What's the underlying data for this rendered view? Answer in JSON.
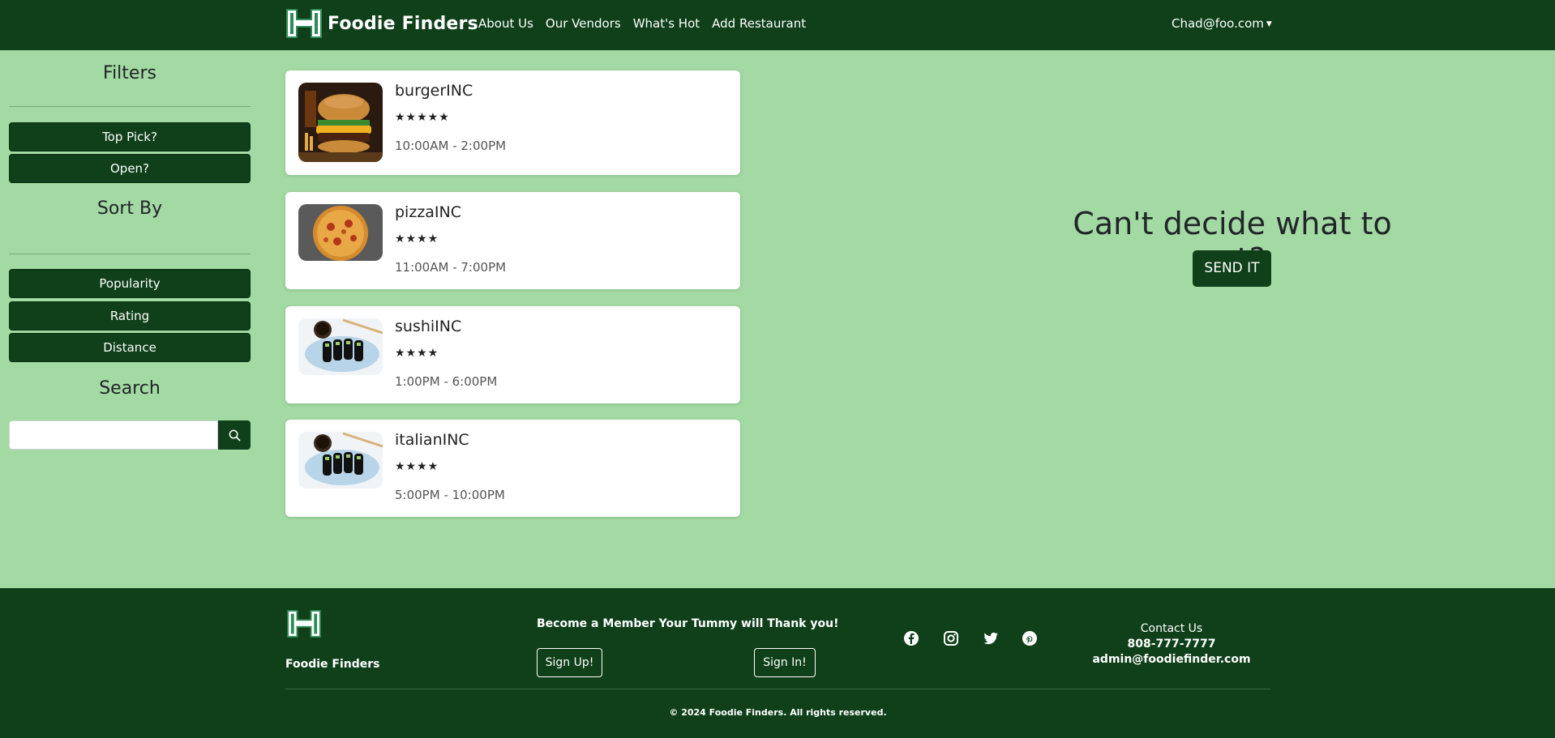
{
  "nav": {
    "brand": "Foodie Finders",
    "links": [
      "About Us",
      "Our Vendors",
      "What's Hot",
      "Add Restaurant"
    ],
    "user": "Chad@foo.com"
  },
  "sidebar": {
    "filters_heading": "Filters",
    "filter_buttons": [
      "Top Pick?",
      "Open?"
    ],
    "sort_heading": "Sort By",
    "sort_buttons": [
      "Popularity",
      "Rating",
      "Distance"
    ],
    "search_heading": "Search",
    "search_placeholder": ""
  },
  "restaurants": [
    {
      "name": "burgerINC",
      "stars": "★★★★★",
      "hours": "10:00AM - 2:00PM",
      "image": "burger"
    },
    {
      "name": "pizzaINC",
      "stars": "★★★★",
      "hours": "11:00AM - 7:00PM",
      "image": "pizza"
    },
    {
      "name": "sushiINC",
      "stars": "★★★★",
      "hours": "1:00PM - 6:00PM",
      "image": "sushi"
    },
    {
      "name": "italianINC",
      "stars": "★★★★",
      "hours": "5:00PM - 10:00PM",
      "image": "sushi"
    }
  ],
  "hero": {
    "title": "Can't decide what to eat?",
    "button": "SEND IT"
  },
  "footer": {
    "brand": "Foodie Finders",
    "tagline": "Become a Member Your Tummy will Thank you!",
    "signup": "Sign Up!",
    "signin": "Sign In!",
    "social_icons": [
      "facebook-icon",
      "instagram-icon",
      "twitter-icon",
      "pinterest-icon"
    ],
    "contact_label": "Contact Us",
    "phone": "808-777-7777",
    "email": "admin@foodiefinder.com",
    "copyright": "© 2024 Foodie Finders. All rights reserved."
  },
  "colors": {
    "primary_green": "#0f4019",
    "background_green": "#a3d9a3"
  }
}
